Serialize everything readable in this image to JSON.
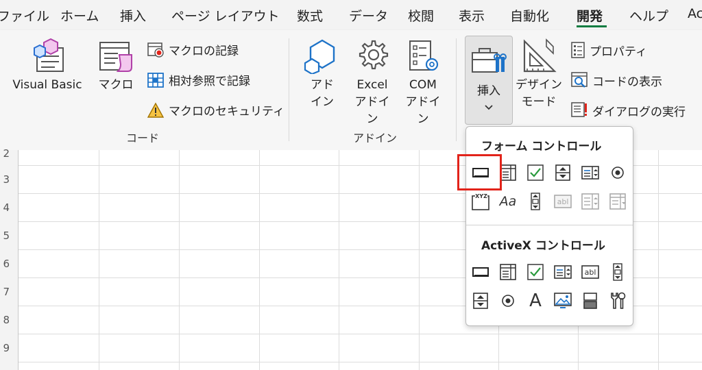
{
  "tabs": [
    "ファイル",
    "ホーム",
    "挿入",
    "ページ レイアウト",
    "数式",
    "データ",
    "校閲",
    "表示",
    "自動化",
    "開発",
    "ヘルプ",
    "Ac"
  ],
  "active_tab": "開発",
  "ribbon": {
    "code_group": {
      "label": "コード",
      "visual_basic": "Visual Basic",
      "macro": "マクロ",
      "record_macro": "マクロの記録",
      "relative_ref": "相対参照で記録",
      "macro_security": "マクロのセキュリティ"
    },
    "addin_group": {
      "label": "アドイン",
      "addin_l1": "アド",
      "addin_l2": "イン",
      "excel_addin_l1": "Excel",
      "excel_addin_l2": "アドイン",
      "com_addin_l1": "COM",
      "com_addin_l2": "アドイン"
    },
    "controls_group": {
      "insert": "挿入",
      "design_mode_l1": "デザイン",
      "design_mode_l2": "モード",
      "properties": "プロパティ",
      "view_code": "コードの表示",
      "run_dialog": "ダイアログの実行"
    }
  },
  "rows": [
    "2",
    "3",
    "4",
    "5",
    "6",
    "7",
    "8",
    "9"
  ],
  "dropdown": {
    "form_controls_title": "フォーム コントロール",
    "form_controls": [
      "button",
      "combo-box",
      "check-box",
      "spin-button",
      "list-box",
      "option-button",
      "group-box",
      "label",
      "scroll-bar",
      "text-field",
      "combo-list-edit",
      "combo-drop-down-edit"
    ],
    "activex_title": "ActiveX コントロール",
    "activex_controls": [
      "command-button",
      "combo-box",
      "check-box",
      "list-box",
      "text-box",
      "scroll-bar",
      "spin-button",
      "option-button",
      "label",
      "image",
      "toggle-button",
      "more-controls"
    ],
    "selected": "button",
    "label_glyph": "Aa",
    "activex_label_glyph": "A",
    "xyz": "XYZ",
    "abl": "abl"
  },
  "colors": {
    "highlight": "#e2231a",
    "accent": "#107c41",
    "icon_blue": "#1e73c8"
  }
}
